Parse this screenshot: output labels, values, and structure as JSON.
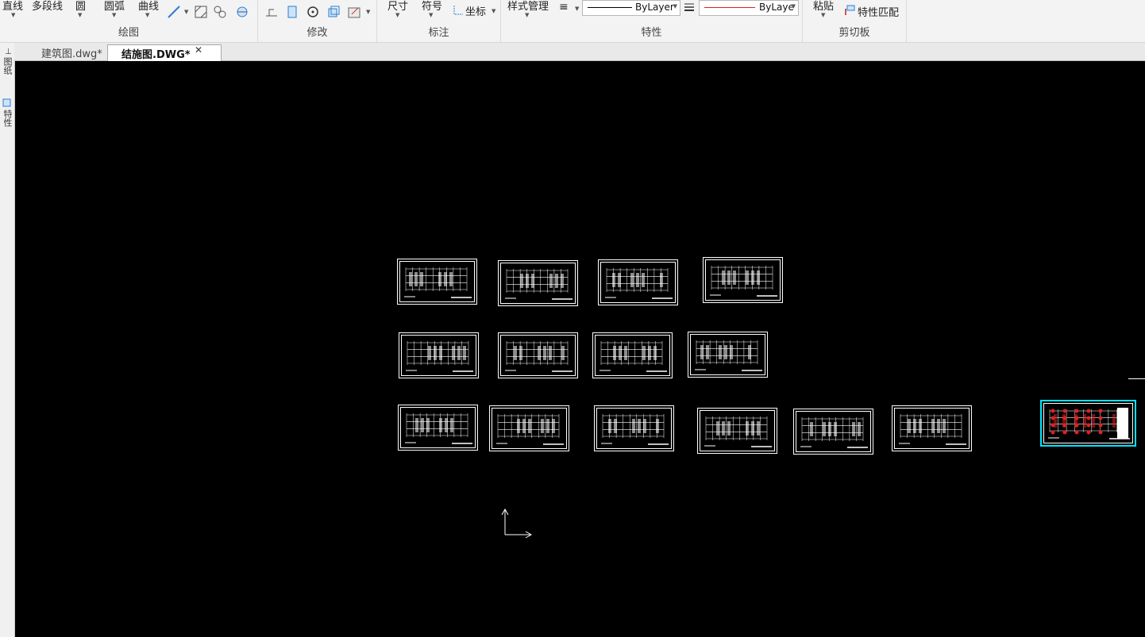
{
  "ribbon": {
    "draw": {
      "label": "绘图",
      "line": "直线",
      "polyline": "多段线",
      "circle": "圆",
      "arc": "圆弧",
      "curve": "曲线"
    },
    "modify": {
      "label": "修改"
    },
    "annotate": {
      "label": "标注",
      "dimension": "尺寸",
      "symbol": "符号",
      "coordinate": "坐标"
    },
    "properties": {
      "label": "特性",
      "style_manager": "样式管理",
      "linetype_value": "ByLayer",
      "lineweight_value": "ByLaye"
    },
    "clipboard": {
      "label": "剪切板",
      "paste": "粘贴",
      "match_properties": "特性匹配"
    }
  },
  "tabs": [
    {
      "label": "建筑图.dwg*",
      "active": false
    },
    {
      "label": "结施图.DWG*",
      "active": true
    }
  ],
  "leftstrip": {
    "panel1": "图纸",
    "panel2": "特性"
  },
  "colors": {
    "canvas": "#000000",
    "selection": "#00e5ff",
    "ribbon_bg": "#f3f3f3",
    "accent_red": "#e02020"
  }
}
